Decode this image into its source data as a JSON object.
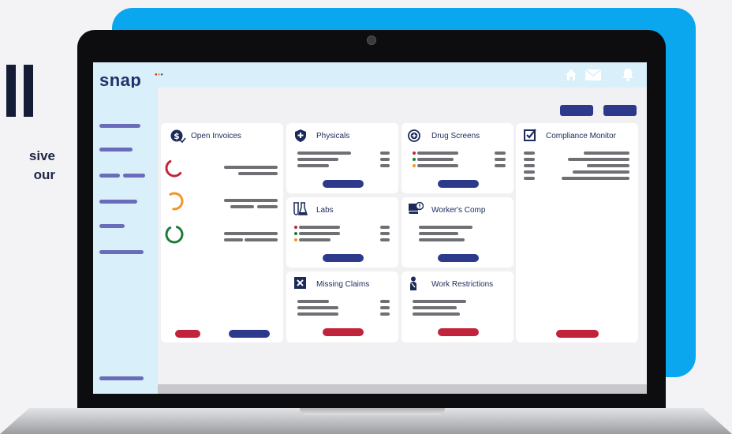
{
  "left_text": {
    "line1": "sive",
    "line2": "our"
  },
  "app": {
    "logo": "snap"
  },
  "topbar_icons": [
    "home-icon",
    "mail-icon",
    "bell-icon"
  ],
  "cards": {
    "open_invoices": {
      "title": "Open Invoices",
      "icon": "dollar-check-icon",
      "rings": [
        {
          "color": "#c1233a",
          "fraction": 0.55
        },
        {
          "color": "#f0952a",
          "fraction": 0.6
        },
        {
          "color": "#1f7a3a",
          "fraction": 0.85
        }
      ]
    },
    "physicals": {
      "title": "Physicals",
      "icon": "shield-plus-icon"
    },
    "drug_screens": {
      "title": "Drug Screens",
      "icon": "plus-circle-icon"
    },
    "compliance_monitor": {
      "title": "Compliance Monitor",
      "icon": "checkbox-icon"
    },
    "labs": {
      "title": "Labs",
      "icon": "flask-icon"
    },
    "workers_comp": {
      "title": "Worker's Comp",
      "icon": "book-alert-icon"
    },
    "missing_claims": {
      "title": "Missing Claims",
      "icon": "x-box-icon"
    },
    "work_restrictions": {
      "title": "Work Restrictions",
      "icon": "person-restriction-icon"
    }
  },
  "colors": {
    "navy": "#2d3a8c",
    "red": "#c1233a",
    "orange": "#f0952a",
    "green": "#1f7a3a",
    "accent_blue": "#0aa7ee"
  }
}
